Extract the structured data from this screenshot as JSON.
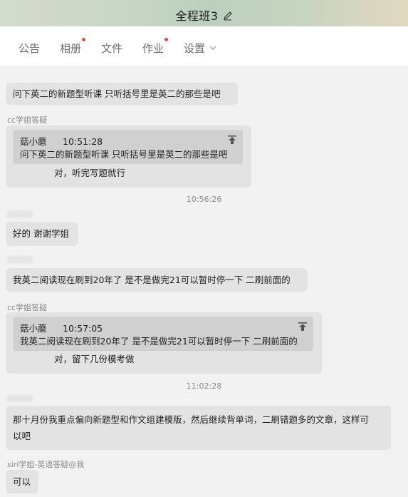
{
  "header": {
    "title": "全程班3"
  },
  "tabs": [
    {
      "label": "公告",
      "dot": false
    },
    {
      "label": "相册",
      "dot": true
    },
    {
      "label": "文件",
      "dot": false
    },
    {
      "label": "作业",
      "dot": true
    },
    {
      "label": "设置",
      "dot": false
    }
  ],
  "messages": {
    "m1": "问下英二的新题型听课 只听括号里是英二的那些是吧",
    "s2": "cc学姐答疑",
    "q2_name": "菇小蘑",
    "q2_time": "10:51:28",
    "q2_text": "问下英二的新题型听课 只听括号里是英二的那些是吧",
    "r2": "对，听完写题就行",
    "t1": "10:56:26",
    "m3": "好的 谢谢学姐",
    "m4": "我英二阅读现在刷到20年了 是不是做完21可以暂时停一下 二刷前面的",
    "s5": "cc学姐答疑",
    "q5_name": "菇小蘑",
    "q5_time": "10:57:05",
    "q5_text": "我英二阅读现在刷到20年了 是不是做完21可以暂时停一下 二刷前面的",
    "r5": "对，留下几份模考做",
    "t2": "11:02:28",
    "m6_l1": "那十月份我重点偏向新题型和作文组建模版，然后继续背单词，二刷错题多的文章，这样可",
    "m6_l2": "以吧",
    "s7": "siri学姐-英语答疑@我",
    "m7": "可以"
  }
}
